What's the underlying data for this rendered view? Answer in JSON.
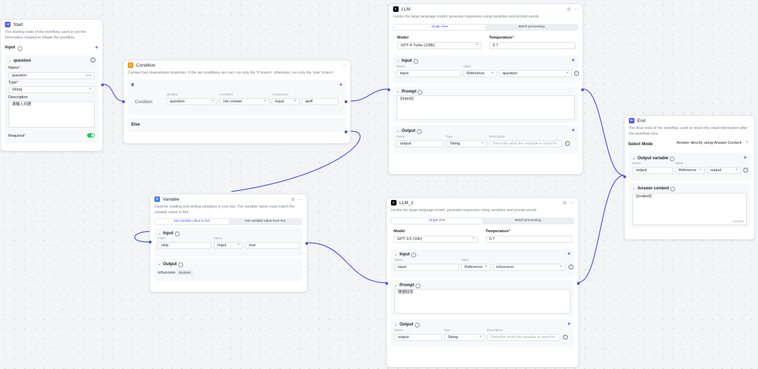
{
  "colors": {
    "accent": "#4d53e8",
    "start": "#5b5ff0",
    "condition": "#f59e0b",
    "variable": "#3b82f6",
    "llm": "#111111",
    "end": "#5b5ff0",
    "toggle": "#22c55e"
  },
  "start": {
    "title": "Start",
    "desc": "The starting node of the workflow, used to set the information needed to initiate the workflow.",
    "input_label": "Input",
    "param_title": "question",
    "name_label": "Name",
    "name_value": "question",
    "name_count": "8/20",
    "type_label": "Type",
    "type_value": "String",
    "desc_label": "Description",
    "desc_value": "请输入问题",
    "required_label": "Required"
  },
  "condition": {
    "title": "Condition",
    "desc": "Connect two downstream branches. If the set conditions are met, run only the 'if' branch; otherwise, run only the 'else' branch.",
    "if_label": "If",
    "col_variable": "Variable",
    "col_condition": "Condition",
    "col_comparison": "Comparison",
    "row_label": "Condition",
    "variable": "question",
    "operator": "not contain",
    "comp_type": "Input",
    "comp_value": "aioff",
    "else_label": "Else"
  },
  "llm": {
    "title": "LLM",
    "desc": "Invoke the large language model, generate responses using variables and prompt words.",
    "tab_single": "Single time",
    "tab_batch": "Batch processing",
    "model_label": "Model",
    "model_value": "GPT-4 Turbo (128k)",
    "temp_label": "Temperature",
    "temp_value": "0.7",
    "input_label": "Input",
    "col_name": "Name",
    "col_value": "Value",
    "in_name": "input",
    "in_type": "Reference",
    "in_value": "question",
    "prompt_label": "Prompt",
    "prompt_value": "{{input}}",
    "output_label": "Output",
    "col_oname": "Name",
    "col_type": "Type",
    "col_desc": "Description",
    "out_name": "output",
    "out_type": "String",
    "out_desc_placeholder": "Describe what the variable is used for"
  },
  "llm1": {
    "title": "LLM_1",
    "desc": "Invoke the large language model, generate responses using variables and prompt words.",
    "tab_single": "Single time",
    "tab_batch": "Batch processing",
    "model_label": "Model",
    "model_value": "GPT-3.5 (16K)",
    "temp_label": "Temperature",
    "temp_value": "0.7",
    "input_label": "Input",
    "col_name": "Name",
    "col_value": "Value",
    "in_name": "input",
    "in_type": "Reference",
    "in_value": "isSuccess",
    "prompt_label": "Prompt",
    "prompt_value": "随便回答",
    "output_label": "Output",
    "col_oname": "Name",
    "col_type": "Type",
    "col_desc": "Description",
    "out_name": "output",
    "out_type": "String",
    "out_desc_placeholder": "Describe what the variable is used for"
  },
  "variable": {
    "title": "Variable",
    "desc": "Used for reading and writing variables in your bot. The variable name must match the variable name in Bot.",
    "tab_set": "Set variable value to bot",
    "tab_get": "Get variable value from bot",
    "input_label": "Input",
    "col_field": "Field",
    "col_value": "Value",
    "field": "skip",
    "val_type": "Input",
    "val_value": "true",
    "output_label": "Output",
    "out_name": "isSuccess",
    "out_type": "Boolean"
  },
  "end": {
    "title": "End",
    "desc": "The final node of the workflow, used to return the result information after the workflow runs.",
    "mode_label": "Select Mode",
    "mode_value": "Answer directly using Answer Content",
    "outvar_label": "Output variable",
    "col_name": "Name",
    "col_value": "Value",
    "var_name": "output",
    "var_type": "Reference",
    "var_value": "output",
    "answer_label": "Answer content",
    "answer_value": "{{output}}",
    "answer_tag": "Variable"
  }
}
